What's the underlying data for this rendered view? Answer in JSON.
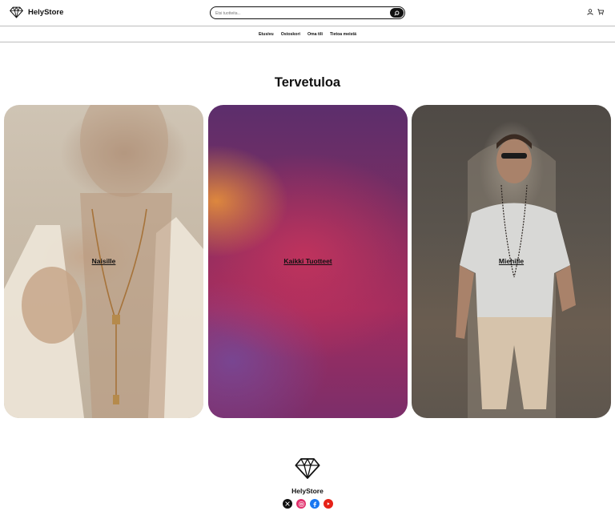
{
  "header": {
    "brand_name": "HelyStore",
    "search_placeholder": "Etsi tuotteita..."
  },
  "nav": {
    "items": [
      "Etusivu",
      "Ostoskori",
      "Oma tili",
      "Tietoa meistä"
    ]
  },
  "hero": {
    "title": "Tervetuloa"
  },
  "cards": [
    {
      "label": "Naisille"
    },
    {
      "label": "Kaikki Tuotteet"
    },
    {
      "label": "Miehille"
    }
  ],
  "footer": {
    "brand_name": "HelyStore",
    "social": [
      "x-icon",
      "instagram-icon",
      "facebook-icon",
      "youtube-icon"
    ]
  },
  "colors": {
    "text": "#111111",
    "instagram": "#e1306c",
    "facebook": "#1877f2",
    "youtube": "#e62117"
  }
}
